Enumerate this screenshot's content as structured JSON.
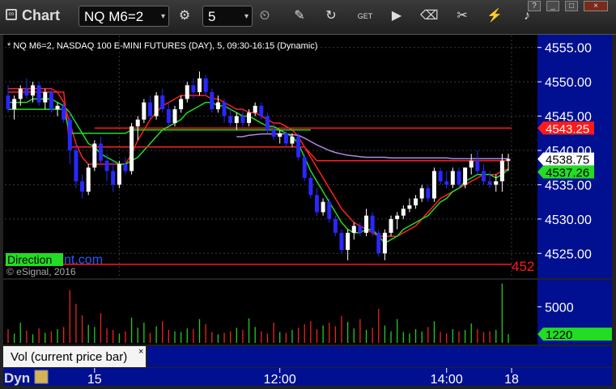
{
  "toolbar": {
    "app_title": "Chart",
    "symbol": "NQ M6=2",
    "interval": "5",
    "icons": [
      "link-icon",
      "interval-settings-icon",
      "clock-icon",
      "draw-icon",
      "refresh-icon",
      "get-icon",
      "play-icon",
      "tools-icon",
      "lightning-icon",
      "twitter-icon"
    ],
    "window_buttons": [
      "?",
      "_",
      "□",
      "×"
    ]
  },
  "chart": {
    "header_text": "* NQ M6=2, NASDAQ 100 E-MINI FUTURES (DAY), 5, 09:30-16:15 (Dynamic)",
    "copyright": "© eSignal, 2016",
    "watermark": "Direction",
    "watermark_suffix": "nt.com",
    "cut_label": "452",
    "bottom_left": "Dyn",
    "volume_label": "Vol (current price bar)",
    "volume_close": "×"
  },
  "chart_data": {
    "type": "candlestick",
    "price_axis": {
      "ticks": [
        4555,
        4550,
        4545,
        4540,
        4535,
        4530,
        4525
      ],
      "range": [
        4521.5,
        4556.5
      ],
      "tick_labels": [
        "4555.00",
        "4550.00",
        "4545.00",
        "4540.00",
        "4535.00",
        "4530.00",
        "4525.00"
      ]
    },
    "volume_axis": {
      "ticks": [
        5000
      ],
      "tick_labels": [
        "5000"
      ],
      "range": [
        0,
        8500
      ]
    },
    "time_axis": {
      "tick_labels": [
        "15",
        "12:00",
        "14:00",
        "18"
      ]
    },
    "price_tags": [
      {
        "label": "4543.25",
        "value": 4543.25,
        "color": "#ff1a1a",
        "text_color": "#ffffff"
      },
      {
        "label": "4538.75",
        "value": 4538.75,
        "color": "#ffffff",
        "text_color": "#000000"
      },
      {
        "label": "4537.26",
        "value": 4537.26,
        "color": "#22dd22",
        "text_color": "#000000"
      }
    ],
    "volume_tag": {
      "label": "1220",
      "value": 1220,
      "color": "#22dd22"
    },
    "horizontal_lines": [
      {
        "value": 4543.25,
        "color": "#ff1a1a",
        "from": 14
      },
      {
        "value": 4523.4,
        "color": "#ff1a1a",
        "from": 0
      }
    ],
    "candles": [
      [
        4548.0,
        4549.5,
        4545.5,
        4546.0
      ],
      [
        4546.0,
        4548.0,
        4544.5,
        4547.5
      ],
      [
        4547.5,
        4549.5,
        4546.5,
        4549.0
      ],
      [
        4549.0,
        4550.5,
        4547.5,
        4548.0
      ],
      [
        4548.0,
        4550.0,
        4547.0,
        4549.5
      ],
      [
        4549.5,
        4550.0,
        4546.5,
        4547.0
      ],
      [
        4547.0,
        4549.0,
        4546.0,
        4548.5
      ],
      [
        4548.5,
        4549.0,
        4545.5,
        4546.0
      ],
      [
        4546.0,
        4547.0,
        4545.0,
        4546.5
      ],
      [
        4546.5,
        4547.0,
        4544.0,
        4544.5
      ],
      [
        4544.5,
        4545.5,
        4538.0,
        4540.0
      ],
      [
        4540.0,
        4541.0,
        4534.5,
        4535.5
      ],
      [
        4535.5,
        4536.5,
        4533.0,
        4534.0
      ],
      [
        4534.0,
        4538.0,
        4533.5,
        4537.5
      ],
      [
        4537.5,
        4541.5,
        4537.0,
        4541.0
      ],
      [
        4541.0,
        4542.0,
        4538.0,
        4538.5
      ],
      [
        4538.5,
        4539.5,
        4535.5,
        4537.0
      ],
      [
        4537.0,
        4538.5,
        4534.0,
        4535.0
      ],
      [
        4535.0,
        4538.5,
        4534.5,
        4538.0
      ],
      [
        4538.0,
        4539.0,
        4536.5,
        4537.0
      ],
      [
        4537.0,
        4544.0,
        4536.5,
        4543.5
      ],
      [
        4543.5,
        4545.0,
        4541.5,
        4544.5
      ],
      [
        4544.5,
        4547.5,
        4544.0,
        4547.0
      ],
      [
        4547.0,
        4548.0,
        4544.5,
        4545.0
      ],
      [
        4545.0,
        4548.5,
        4544.5,
        4548.0
      ],
      [
        4548.0,
        4549.0,
        4545.5,
        4546.0
      ],
      [
        4546.0,
        4547.0,
        4543.5,
        4544.0
      ],
      [
        4544.0,
        4546.5,
        4543.5,
        4546.0
      ],
      [
        4546.0,
        4548.0,
        4545.5,
        4547.5
      ],
      [
        4547.5,
        4550.0,
        4547.0,
        4549.5
      ],
      [
        4549.5,
        4550.5,
        4547.5,
        4548.5
      ],
      [
        4548.5,
        4551.5,
        4548.0,
        4550.5
      ],
      [
        4550.5,
        4551.0,
        4548.0,
        4548.5
      ],
      [
        4548.5,
        4549.0,
        4545.5,
        4546.0
      ],
      [
        4546.0,
        4548.0,
        4545.5,
        4547.0
      ],
      [
        4547.0,
        4547.5,
        4544.0,
        4545.0
      ],
      [
        4545.0,
        4546.0,
        4543.5,
        4544.0
      ],
      [
        4544.0,
        4545.5,
        4543.0,
        4545.0
      ],
      [
        4545.0,
        4546.0,
        4543.5,
        4544.0
      ],
      [
        4544.0,
        4546.0,
        4543.5,
        4545.5
      ],
      [
        4545.5,
        4547.0,
        4545.0,
        4546.5
      ],
      [
        4546.5,
        4547.0,
        4544.5,
        4545.0
      ],
      [
        4545.0,
        4545.5,
        4542.5,
        4543.0
      ],
      [
        4543.0,
        4544.0,
        4541.5,
        4542.0
      ],
      [
        4542.0,
        4543.0,
        4541.0,
        4542.5
      ],
      [
        4542.5,
        4543.0,
        4540.5,
        4541.0
      ],
      [
        4541.0,
        4542.5,
        4540.5,
        4542.0
      ],
      [
        4542.0,
        4542.5,
        4538.5,
        4539.0
      ],
      [
        4539.0,
        4539.5,
        4535.5,
        4536.0
      ],
      [
        4536.0,
        4536.5,
        4533.0,
        4533.5
      ],
      [
        4533.5,
        4534.5,
        4530.5,
        4531.0
      ],
      [
        4531.0,
        4533.0,
        4530.5,
        4532.5
      ],
      [
        4532.5,
        4533.0,
        4529.5,
        4530.0
      ],
      [
        4530.0,
        4530.5,
        4527.5,
        4528.0
      ],
      [
        4528.0,
        4528.5,
        4525.0,
        4525.5
      ],
      [
        4525.5,
        4528.5,
        4524.0,
        4528.0
      ],
      [
        4528.0,
        4529.5,
        4527.0,
        4529.0
      ],
      [
        4529.0,
        4529.5,
        4527.5,
        4528.0
      ],
      [
        4528.0,
        4531.5,
        4527.5,
        4530.5
      ],
      [
        4530.5,
        4531.0,
        4527.5,
        4528.0
      ],
      [
        4528.0,
        4528.5,
        4524.5,
        4525.0
      ],
      [
        4525.0,
        4528.5,
        4524.0,
        4528.0
      ],
      [
        4528.0,
        4530.5,
        4527.5,
        4530.0
      ],
      [
        4530.0,
        4531.0,
        4528.5,
        4530.5
      ],
      [
        4530.5,
        4532.0,
        4530.0,
        4531.5
      ],
      [
        4531.5,
        4533.0,
        4531.0,
        4532.0
      ],
      [
        4532.0,
        4533.5,
        4531.5,
        4533.0
      ],
      [
        4533.0,
        4535.0,
        4532.5,
        4534.5
      ],
      [
        4534.5,
        4535.0,
        4532.5,
        4533.0
      ],
      [
        4533.0,
        4537.5,
        4532.5,
        4537.0
      ],
      [
        4537.0,
        4537.5,
        4535.0,
        4535.5
      ],
      [
        4535.5,
        4537.0,
        4534.5,
        4535.0
      ],
      [
        4535.0,
        4537.5,
        4534.5,
        4537.0
      ],
      [
        4537.0,
        4537.5,
        4534.5,
        4535.0
      ],
      [
        4535.0,
        4537.5,
        4534.5,
        4537.5
      ],
      [
        4537.5,
        4539.5,
        4536.5,
        4538.5
      ],
      [
        4538.5,
        4540.0,
        4536.5,
        4537.0
      ],
      [
        4537.0,
        4538.0,
        4535.0,
        4535.5
      ],
      [
        4535.5,
        4537.0,
        4534.5,
        4535.0
      ],
      [
        4535.0,
        4536.5,
        4534.0,
        4535.5
      ],
      [
        4535.5,
        4539.5,
        4534.0,
        4538.5
      ],
      [
        4538.5,
        4539.5,
        4537.0,
        4538.75
      ]
    ],
    "volumes": [
      1900,
      1300,
      2800,
      1700,
      1200,
      2000,
      1400,
      1600,
      1900,
      2200,
      7300,
      5400,
      3800,
      2500,
      2200,
      4100,
      2000,
      1800,
      1300,
      1600,
      3500,
      2100,
      2800,
      1400,
      2300,
      3000,
      1800,
      1600,
      1500,
      2000,
      1900,
      3300,
      2600,
      1500,
      1200,
      1400,
      1600,
      2100,
      1800,
      3400,
      2200,
      1600,
      1300,
      2800,
      1500,
      1400,
      1800,
      2100,
      2600,
      3000,
      1900,
      2400,
      2800,
      2300,
      3700,
      2900,
      2000,
      3300,
      1800,
      2100,
      4700,
      2400,
      1600,
      3300,
      1500,
      1300,
      1900,
      1600,
      2200,
      3000,
      1500,
      1300,
      1900,
      1600,
      1800,
      2700,
      1900,
      1500,
      1600,
      1800,
      8200,
      1220
    ],
    "series": [
      {
        "color": "#ff2020",
        "values": [
          4549.0,
          4549.0,
          4549.0,
          4549.0,
          4549.0,
          4549.0,
          4549.0,
          4549.0,
          4548.5,
          4547.0,
          4544.0,
          4541.0,
          4539.0,
          4538.0,
          4538.0,
          4538.0,
          4538.0,
          4538.0,
          4538.0,
          4538.0,
          4539.5,
          4541.5,
          4543.0,
          4544.5,
          4545.5,
          4546.5,
          4547.0,
          4547.5,
          4548.0,
          4548.0,
          4548.0,
          4548.0,
          4548.0,
          4547.5,
          4547.5,
          4547.0,
          4546.5,
          4546.0,
          4546.0,
          4545.5,
          4545.5,
          4545.0,
          4544.5,
          4544.0,
          4544.0,
          4543.5,
          4543.0,
          4542.0,
          4540.5,
          4539.0,
          4537.5,
          4536.0,
          4534.5,
          4533.0,
          4531.5,
          4530.5,
          4529.5,
          4529.0,
          4528.5,
          4528.0,
          4527.5,
          4527.5,
          4527.5,
          4527.5,
          4528.0,
          4528.5,
          4529.0,
          4530.0,
          4531.0,
          4532.0,
          4533.0,
          4533.5,
          4534.0,
          4534.5,
          4535.0,
          4535.5,
          4536.0,
          4536.5,
          4536.5,
          4536.5,
          4537.0,
          4537.3
        ]
      },
      {
        "color": "#22dd22",
        "values": [
          4547.0,
          4547.0,
          4547.0,
          4547.0,
          4547.5,
          4547.5,
          4547.5,
          4547.5,
          4547.0,
          4546.5,
          4545.5,
          4544.0,
          4542.5,
          4541.0,
          4540.5,
          4539.5,
          4539.0,
          4538.5,
          4538.0,
          4538.0,
          4538.5,
          4539.0,
          4540.0,
          4541.0,
          4542.0,
          4543.0,
          4543.5,
          4544.0,
          4544.5,
          4545.5,
          4546.0,
          4546.5,
          4547.0,
          4547.0,
          4546.5,
          4546.5,
          4546.0,
          4545.5,
          4545.0,
          4545.0,
          4544.5,
          4544.0,
          4543.5,
          4543.5,
          4543.0,
          4542.5,
          4542.0,
          4541.0,
          4539.0,
          4537.0,
          4535.5,
          4534.0,
          4532.5,
          4531.0,
          4529.5,
          4528.5,
          4528.0,
          4528.0,
          4528.5,
          4528.5,
          4527.5,
          4526.5,
          4527.0,
          4527.5,
          4528.5,
          4529.0,
          4529.5,
          4530.0,
          4530.5,
          4531.5,
          4532.5,
          4533.0,
          4534.0,
          4534.5,
          4535.5,
          4536.0,
          4536.5,
          4536.5,
          4536.5,
          4536.0,
          4536.5,
          4537.26
        ]
      },
      {
        "color": "#ff2020",
        "values": [
          4548.5,
          4548.5,
          4548.5,
          4548.5,
          4548.5,
          4548.5,
          4548.5,
          4548.5,
          4548.5,
          4548.5,
          4540.5,
          4540.5,
          4540.5,
          4540.5,
          4540.5,
          4540.5,
          4540.5,
          4540.5,
          4540.5,
          4540.5,
          4540.5,
          4540.5,
          4540.5,
          4540.5,
          4540.5,
          4540.5,
          4540.5,
          4540.5,
          4540.5,
          4540.5,
          4540.5,
          4540.5,
          4540.5,
          4540.5,
          4540.5,
          4540.5,
          4540.5,
          4540.5,
          4540.5,
          4540.5,
          4540.5,
          4540.5,
          4540.5,
          4540.5,
          4540.5,
          4540.5,
          4540.5,
          4540.5,
          4540.5,
          4539.5,
          4538.5,
          4538.5,
          4538.5,
          4538.5,
          4538.5,
          4538.5,
          4538.5,
          4538.5,
          4538.5,
          4538.5,
          4538.5,
          4538.5,
          4538.5,
          4538.5,
          4538.5,
          4538.5,
          4538.5,
          4538.5,
          4538.5,
          4538.5,
          4538.5,
          4538.5,
          4538.5,
          4538.5,
          4538.5,
          4538.5,
          4538.5,
          4538.5,
          4538.5,
          4538.5,
          4538.5,
          4538.5
        ]
      },
      {
        "color": "#22dd22",
        "values": [
          4546.0,
          4546.0,
          4546.0,
          4546.0,
          4546.0,
          4546.0,
          4546.0,
          4546.0,
          4546.0,
          4546.0,
          4542.5,
          4542.5,
          4542.5,
          4542.5,
          4542.5,
          4542.5,
          4542.5,
          4542.5,
          4542.5,
          4542.5,
          4543.0,
          4543.0,
          4543.0,
          4543.0,
          4543.0,
          4543.0,
          4543.0,
          4543.0,
          4543.0,
          4543.0,
          4543.0,
          4543.0,
          4543.0,
          4543.0,
          4543.0,
          4543.0,
          4543.0,
          4543.0,
          4543.0,
          4543.0,
          4543.0,
          4543.0,
          4543.0,
          4543.0,
          4543.0,
          4543.0,
          4543.0,
          4543.0,
          4543.0,
          4543.0
        ]
      },
      {
        "color": "#b088e0",
        "values": [
          null,
          null,
          null,
          null,
          null,
          null,
          null,
          null,
          null,
          null,
          null,
          null,
          null,
          null,
          null,
          null,
          null,
          null,
          null,
          null,
          null,
          null,
          null,
          null,
          null,
          null,
          null,
          null,
          null,
          null,
          null,
          null,
          null,
          null,
          null,
          null,
          null,
          4542.0,
          4542.0,
          4542.2,
          4542.3,
          4542.4,
          4542.4,
          4542.4,
          4542.4,
          4542.4,
          4542.3,
          4542.2,
          4541.8,
          4541.3,
          4540.8,
          4540.4,
          4540.0,
          4539.7,
          4539.5,
          4539.3,
          4539.2,
          4539.1,
          4539.0,
          4539.0,
          4539.0,
          4539.0,
          4538.9,
          4538.9,
          4538.9,
          4538.9,
          4538.9,
          4538.9,
          4538.9,
          4538.9,
          4538.9,
          4538.9,
          4538.8,
          4538.8,
          4538.8,
          4538.8,
          4538.8,
          4538.8,
          4538.8,
          4538.8,
          4538.8,
          4538.8
        ]
      }
    ]
  }
}
